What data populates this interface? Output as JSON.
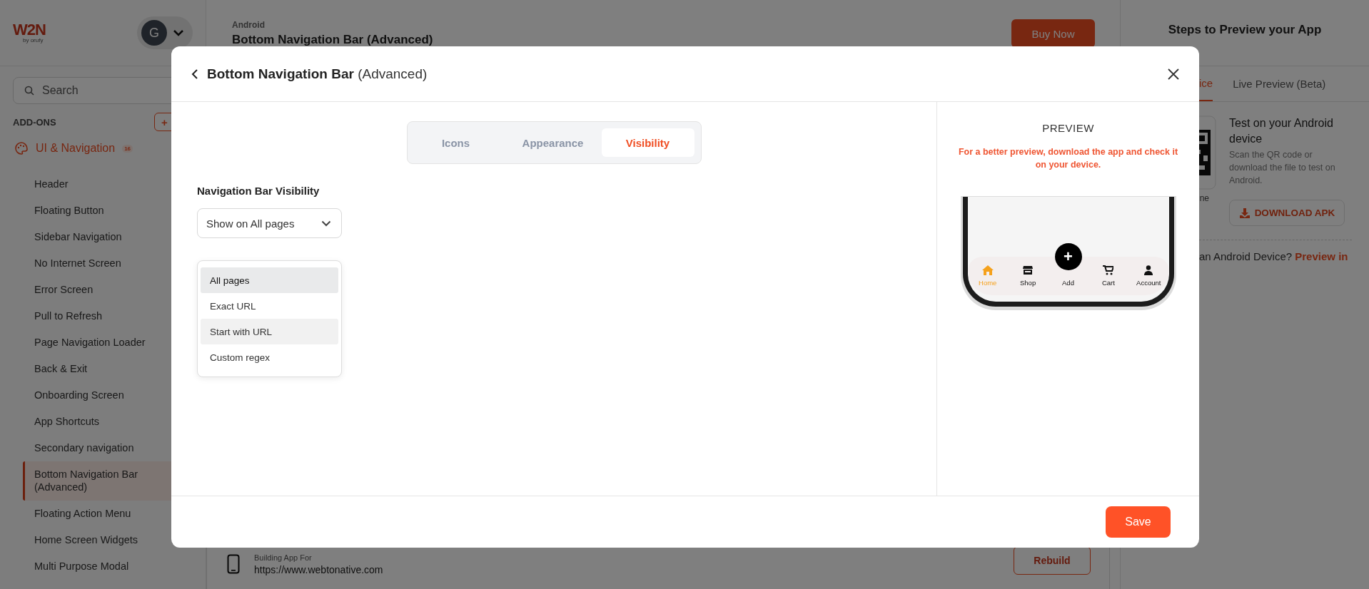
{
  "sidebar": {
    "logo": {
      "mark": "W2N",
      "tagline": "by orufy"
    },
    "avatar": "G",
    "search": {
      "placeholder": "Search"
    },
    "section": "ADD-ONS",
    "add_button": "+",
    "group": {
      "label": "UI & Navigation",
      "count": "16"
    },
    "items": [
      {
        "label": "Header",
        "selected": false
      },
      {
        "label": "Floating Button",
        "selected": false
      },
      {
        "label": "Sidebar Navigation",
        "selected": false
      },
      {
        "label": "No Internet Screen",
        "selected": false
      },
      {
        "label": "Error Screen",
        "selected": false
      },
      {
        "label": "Pull to Refresh",
        "selected": false
      },
      {
        "label": "Page Navigation Loader",
        "selected": false
      },
      {
        "label": "Back & Exit",
        "selected": false
      },
      {
        "label": "Onboarding Screen",
        "selected": false
      },
      {
        "label": "App Shortcuts",
        "selected": false
      },
      {
        "label": "Secondary navigation",
        "selected": false
      },
      {
        "label": "Bottom Navigation Bar (Advanced)",
        "selected": true
      },
      {
        "label": "Floating Action Menu",
        "selected": false
      },
      {
        "label": "Home Screen Widgets",
        "selected": false
      },
      {
        "label": "Multi Purpose Modal",
        "selected": false
      }
    ]
  },
  "header": {
    "platform": "Android",
    "title": "Bottom Navigation Bar (Advanced)",
    "buy_button": "Buy Now"
  },
  "build_bar": {
    "label": "Building App For",
    "url": "https://www.webtonative.com",
    "rebuild_button": "Rebuild"
  },
  "right_panel": {
    "title": "Steps to Preview your App",
    "tabs": [
      {
        "label": "ice",
        "selected": true
      },
      {
        "label": "Live Preview (Beta)",
        "selected": false
      }
    ],
    "qr_caption": "ne",
    "heading": "Test on your Android device",
    "description": "Scan the QR code or download the file to test on Android.",
    "download_button": "DOWNLOAD APK",
    "footer": "an Android Device? **Preview in**"
  },
  "modal": {
    "title": "Bottom Navigation Bar",
    "subtitle": "(Advanced)",
    "tabs": [
      {
        "label": "Icons",
        "selected": false
      },
      {
        "label": "Appearance",
        "selected": false
      },
      {
        "label": "Visibility",
        "selected": true
      }
    ],
    "field_label": "Navigation Bar Visibility",
    "select_value": "Show on All pages",
    "options": [
      {
        "label": "All pages",
        "selected": true,
        "hovered": false
      },
      {
        "label": "Exact URL",
        "selected": false,
        "hovered": false
      },
      {
        "label": "Start with URL",
        "selected": false,
        "hovered": true
      },
      {
        "label": "Custom regex",
        "selected": false,
        "hovered": false
      }
    ],
    "preview": {
      "title": "PREVIEW",
      "note": "For a better preview, download the app and check it on your device.",
      "add_button": "+",
      "nav_items": [
        {
          "label": "Home",
          "selected": true
        },
        {
          "label": "Shop",
          "selected": false
        },
        {
          "label": "Add",
          "selected": false
        },
        {
          "label": "Cart",
          "selected": false
        },
        {
          "label": "Account",
          "selected": false
        }
      ]
    },
    "save_button": "Save"
  }
}
